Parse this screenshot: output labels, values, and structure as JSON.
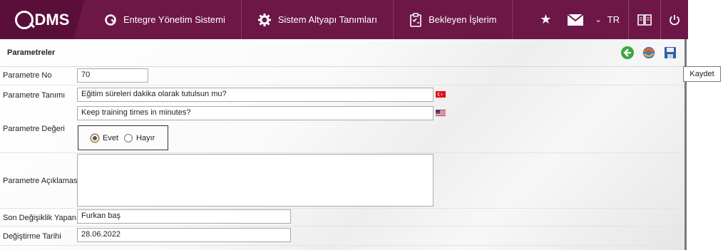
{
  "brand": {
    "logo_text": "DMS",
    "logo_letter": "Q"
  },
  "nav": {
    "items": [
      {
        "label": "Entegre Yönetim Sistemi",
        "icon": "q-logo-icon"
      },
      {
        "label": "Sistem Altyapı Tanımları",
        "icon": "gear-icon"
      },
      {
        "label": "Bekleyen İşlerim",
        "icon": "clipboard-icon"
      }
    ],
    "right": {
      "star_icon": "star-icon",
      "mail_icon": "mail-icon",
      "language": "TR",
      "chevron": "⌄",
      "book_icon": "book-icon",
      "power_icon": "power-icon"
    }
  },
  "panel": {
    "title": "Parametreler",
    "tools": [
      "back-icon",
      "refresh-icon",
      "save-icon"
    ],
    "tooltip": "Kaydet"
  },
  "form": {
    "param_no_label": "Parametre No",
    "param_no_value": "70",
    "param_def_label": "Parametre Tanımı",
    "param_def_tr": "Eğitim süreleri dakika olarak tutulsun mu?",
    "param_def_en": "Keep training times in minutes?",
    "param_value_label": "Parametre Değeri",
    "radio_yes": "Evet",
    "radio_no": "Hayır",
    "selected": "Evet",
    "param_desc_label": "Parametre Açıklaması",
    "param_desc_value": "",
    "last_modifier_label": "Son Değişiklik Yapan",
    "last_modifier_value": "Furkan baş",
    "modified_date_label": "Değiştirme Tarihi",
    "modified_date_value": "28.06.2022"
  },
  "colors": {
    "topbar": "#6d1747",
    "logo_bg": "#5a0f3a"
  }
}
